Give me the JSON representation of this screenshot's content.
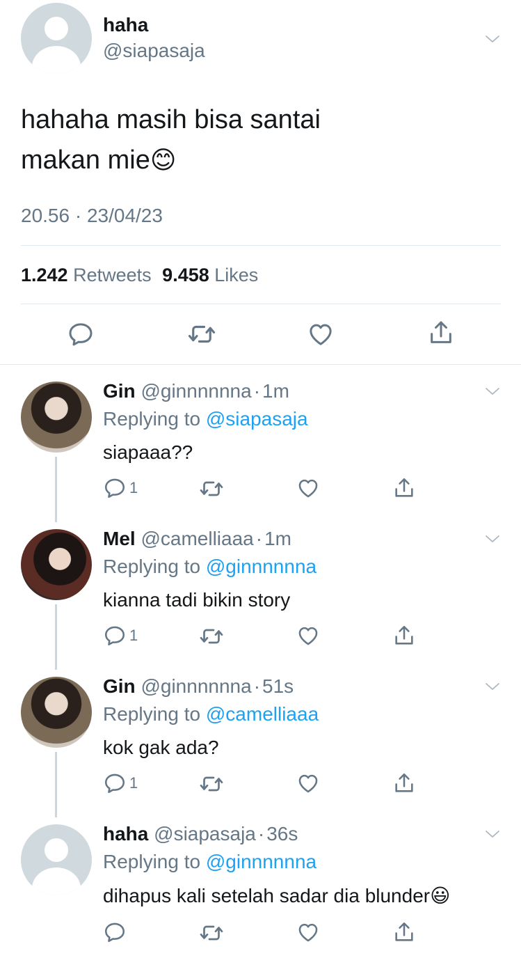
{
  "main_tweet": {
    "display_name": "haha",
    "handle": "@siapasaja",
    "text_line1": "hahaha masih bisa santai",
    "text_line2": "makan mie",
    "emoji": "😊",
    "timestamp": "20.56 · 23/04/23",
    "retweets_count": "1.242",
    "retweets_label": "Retweets",
    "likes_count": "9.458",
    "likes_label": "Likes"
  },
  "replies": [
    {
      "display_name": "Gin",
      "handle": "@ginnnnnna",
      "sep": "·",
      "time": "1m",
      "replying_prefix": "Replying to",
      "replying_to": "@siapasaja",
      "text": "siapaaa??",
      "reply_count": "1"
    },
    {
      "display_name": "Mel",
      "handle": "@camelliaaa",
      "sep": "·",
      "time": "1m",
      "replying_prefix": "Replying to",
      "replying_to": "@ginnnnnna",
      "text": "kianna tadi bikin story",
      "reply_count": "1"
    },
    {
      "display_name": "Gin",
      "handle": "@ginnnnnna",
      "sep": "·",
      "time": "51s",
      "replying_prefix": "Replying to",
      "replying_to": "@camelliaaa",
      "text": "kok gak ada?",
      "reply_count": "1"
    },
    {
      "display_name": "haha",
      "handle": "@siapasaja",
      "sep": "·",
      "time": "36s",
      "replying_prefix": "Replying to",
      "replying_to": "@ginnnnnna",
      "text": "dihapus kali setelah sadar dia blunder",
      "emoji": "😃",
      "reply_count": ""
    }
  ],
  "icons": {
    "reply": "reply-icon",
    "retweet": "retweet-icon",
    "like": "heart-icon",
    "share": "share-icon",
    "more": "chevron-down-icon"
  },
  "colors": {
    "accent": "#1da1f2",
    "secondary_text": "#657786",
    "divider": "#e1e8ed",
    "avatar_placeholder": "#cfd9de"
  }
}
